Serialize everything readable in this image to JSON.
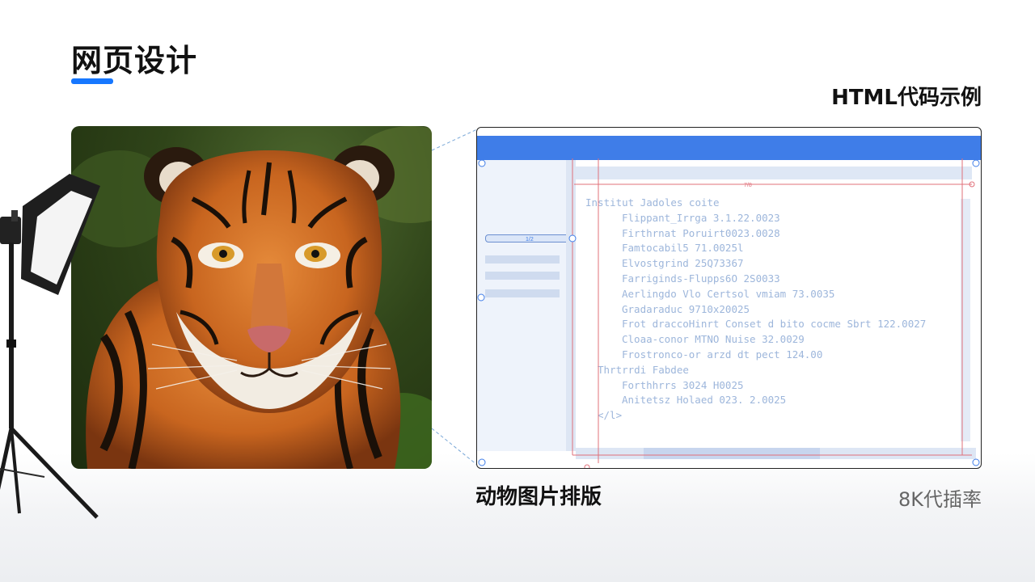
{
  "page": {
    "title": "网页设计",
    "accent_color": "#1677ff"
  },
  "showcase": {
    "heading": "HTML代码示例",
    "caption": "动物图片排版",
    "resolution": "8K代插率"
  },
  "photo": {
    "subject_icon": "tiger-photo",
    "lamp_icon": "softbox-light-icon"
  },
  "wireframe": {
    "header_color": "#3f7de8",
    "side_slider_label": "1/2",
    "guide_width_label": "7/8",
    "code_lines": [
      {
        "indent": 0,
        "text": "Institut Jadoles coite"
      },
      {
        "indent": 3,
        "text": "Flippant_Irrga  3.1.22.0023"
      },
      {
        "indent": 3,
        "text": "Firthrnat  Poruirt0023.0028"
      },
      {
        "indent": 3,
        "text": "Famtocabil5  71.0025l"
      },
      {
        "indent": 3,
        "text": "Elvostgrind  25Q73367"
      },
      {
        "indent": 3,
        "text": "Farriginds-Flupps6O  2S0033"
      },
      {
        "indent": 3,
        "text": "Aerlingdo Vlo Certsol vmiam  73.0035"
      },
      {
        "indent": 3,
        "text": "Gradaraduc  9710x20025"
      },
      {
        "indent": 3,
        "text": "Frot draccoHinrt Conset d bito cocme Sbrt  122.0027"
      },
      {
        "indent": 3,
        "text": "Cloaa-conor  MTNO Nuise  32.0029"
      },
      {
        "indent": 3,
        "text": "Frostronco-or arzd dt pect  124.00"
      },
      {
        "indent": 1,
        "text": "Thrtrrdi Fabdee"
      },
      {
        "indent": 3,
        "text": "Forthhrrs  3024 H0025"
      },
      {
        "indent": 3,
        "text": "Anitetsz Holaed 023. 2.0025"
      },
      {
        "indent": 1,
        "text": "</l>"
      }
    ]
  }
}
